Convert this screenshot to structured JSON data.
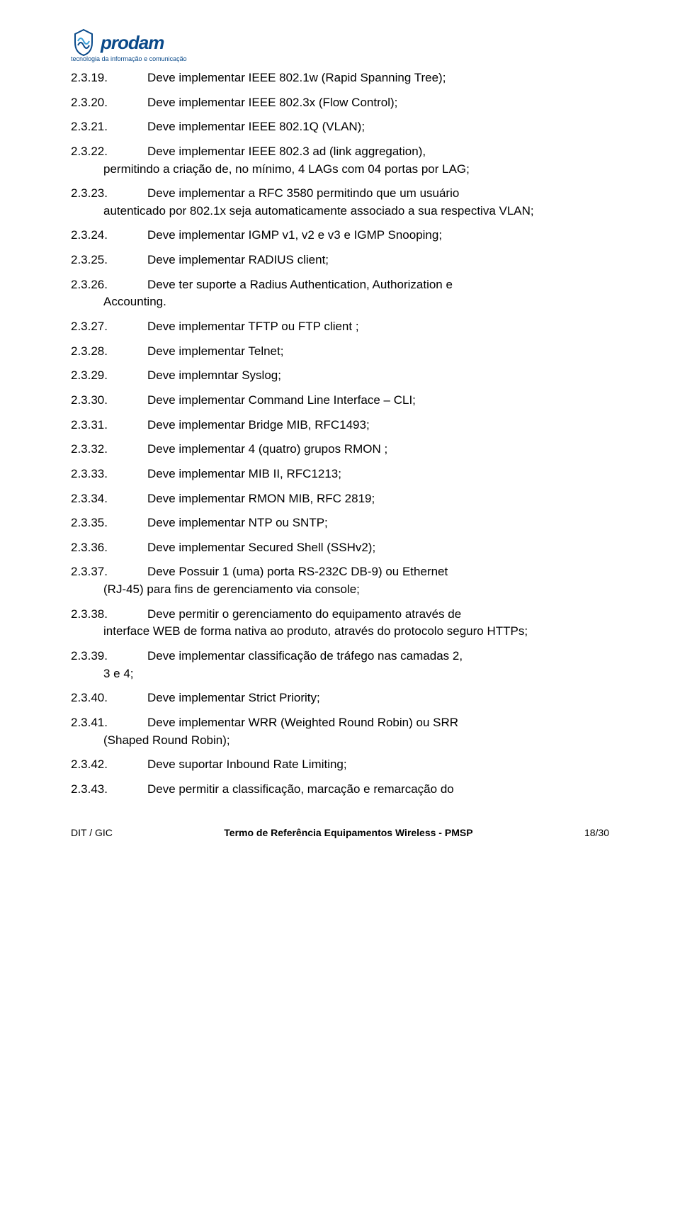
{
  "logo": {
    "name": "prodam",
    "tagline": "tecnologia da informação e comunicação"
  },
  "items": [
    {
      "num": "2.3.19.",
      "text": "Deve implementar IEEE 802.1w (Rapid Spanning Tree);",
      "mode": "tab"
    },
    {
      "num": "2.3.20.",
      "text": "Deve implementar IEEE 802.3x (Flow Control);",
      "mode": "tab"
    },
    {
      "num": "2.3.21.",
      "text": "Deve implementar IEEE 802.1Q (VLAN);",
      "mode": "tab"
    },
    {
      "num": "2.3.22.",
      "lead": "Deve implementar IEEE 802.3 ad (link aggregation),",
      "cont": "permitindo a criação de, no mínimo, 4 LAGs com 04 portas por LAG;",
      "mode": "wrap"
    },
    {
      "num": "2.3.23.",
      "lead": "Deve implementar a RFC 3580 permitindo que um usuário",
      "cont": "autenticado por 802.1x seja automaticamente associado a sua respectiva VLAN;",
      "mode": "wrap"
    },
    {
      "num": "2.3.24.",
      "text": "Deve implementar IGMP v1, v2 e v3 e IGMP Snooping;",
      "mode": "tab"
    },
    {
      "num": "2.3.25.",
      "text": "Deve implementar RADIUS client;",
      "mode": "tab"
    },
    {
      "num": "2.3.26.",
      "lead": "Deve ter suporte a Radius Authentication, Authorization e",
      "cont": "Accounting.",
      "mode": "wrap"
    },
    {
      "num": "2.3.27.",
      "text": "Deve implementar TFTP ou FTP client ;",
      "mode": "tab"
    },
    {
      "num": "2.3.28.",
      "text": "Deve implementar Telnet;",
      "mode": "tab"
    },
    {
      "num": "2.3.29.",
      "text": "Deve implemntar Syslog;",
      "mode": "tab"
    },
    {
      "num": "2.3.30.",
      "text": "Deve implementar Command Line Interface – CLI;",
      "mode": "tab"
    },
    {
      "num": "2.3.31.",
      "text": "Deve implementar Bridge MIB, RFC1493;",
      "mode": "tab"
    },
    {
      "num": "2.3.32.",
      "text": "Deve implementar 4 (quatro) grupos RMON ;",
      "mode": "tab"
    },
    {
      "num": "2.3.33.",
      "text": "Deve implementar MIB II, RFC1213;",
      "mode": "tab"
    },
    {
      "num": "2.3.34.",
      "text": "Deve implementar RMON MIB, RFC 2819;",
      "mode": "tab"
    },
    {
      "num": "2.3.35.",
      "text": "Deve implementar NTP ou SNTP;",
      "mode": "tab"
    },
    {
      "num": "2.3.36.",
      "text": "Deve implementar Secured Shell (SSHv2);",
      "mode": "tab"
    },
    {
      "num": "2.3.37.",
      "lead": "Deve Possuir 1 (uma) porta RS-232C DB-9) ou Ethernet",
      "cont": "(RJ-45) para fins de gerenciamento via console;",
      "mode": "wrap"
    },
    {
      "num": "2.3.38.",
      "lead": "Deve permitir o gerenciamento do equipamento através de",
      "cont": "interface WEB de forma nativa ao produto, através do protocolo seguro HTTPs;",
      "mode": "wrap"
    },
    {
      "num": "2.3.39.",
      "lead": "Deve implementar classificação de tráfego nas camadas 2,",
      "cont": "3 e 4;",
      "mode": "wrap"
    },
    {
      "num": "2.3.40.",
      "text": "Deve implementar Strict Priority;",
      "mode": "tab"
    },
    {
      "num": "2.3.41.",
      "lead": "Deve implementar WRR (Weighted Round Robin) ou SRR",
      "cont": "(Shaped Round Robin);",
      "mode": "wrap"
    },
    {
      "num": "2.3.42.",
      "text": "Deve suportar Inbound Rate Limiting;",
      "mode": "tab"
    },
    {
      "num": "2.3.43.",
      "text": "Deve permitir a classificação, marcação e remarcação do",
      "mode": "tab"
    }
  ],
  "footer": {
    "left": "DIT / GIC",
    "center": "Termo de Referência Equipamentos Wireless - PMSP",
    "right": "18/30"
  }
}
